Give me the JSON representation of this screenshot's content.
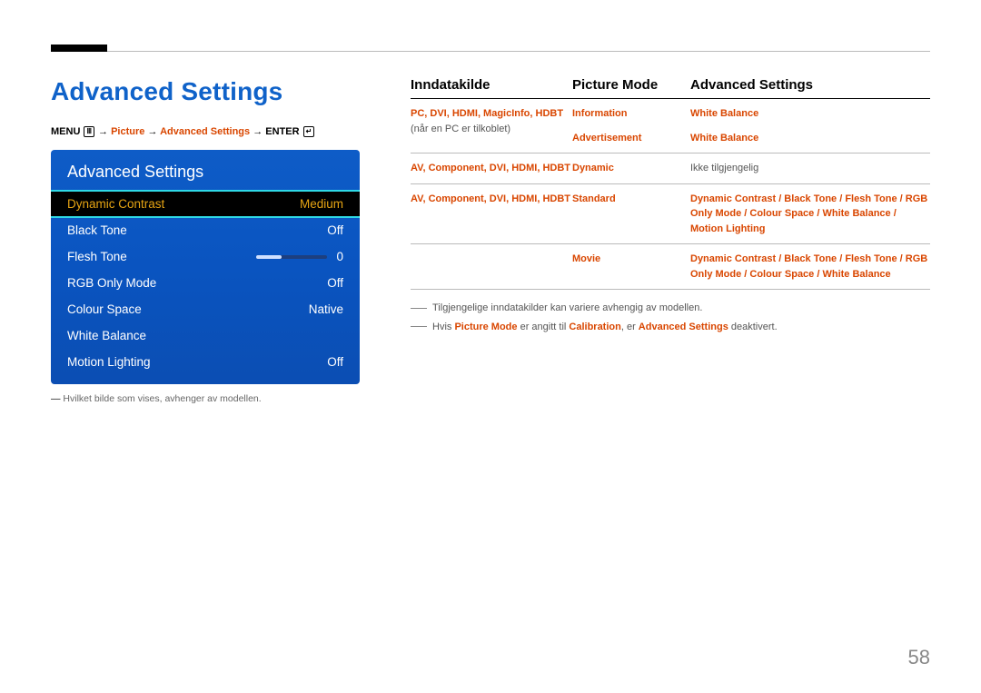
{
  "page": {
    "title": "Advanced Settings",
    "number": "58"
  },
  "breadcrumb": {
    "menu": "MENU",
    "arrow": "→",
    "picture": "Picture",
    "advanced": "Advanced Settings",
    "enter": "ENTER"
  },
  "osd": {
    "title": "Advanced Settings",
    "rows": [
      {
        "label": "Dynamic Contrast",
        "value": "Medium",
        "selected": true
      },
      {
        "label": "Black Tone",
        "value": "Off"
      },
      {
        "label": "Flesh Tone",
        "value": "0",
        "slider": true
      },
      {
        "label": "RGB Only Mode",
        "value": "Off"
      },
      {
        "label": "Colour Space",
        "value": "Native"
      },
      {
        "label": "White Balance",
        "value": ""
      },
      {
        "label": "Motion Lighting",
        "value": "Off"
      }
    ]
  },
  "footnote_left": "Hvilket bilde som vises, avhenger av modellen.",
  "table": {
    "headers": {
      "a": "Inndatakilde",
      "b": "Picture Mode",
      "c": "Advanced Settings"
    },
    "rows": [
      {
        "a_bold": "PC, DVI, HDMI, MagicInfo, HDBT",
        "a_tail": " (når en PC er tilkoblet)",
        "b1": "Information",
        "b2": "Advertisement",
        "c1": "White Balance",
        "c2": "White Balance"
      },
      {
        "a_bold": "AV, Component, DVI, HDMI, HDBT",
        "b1": "Dynamic",
        "c_plain": "Ikke tilgjengelig"
      },
      {
        "a_bold": "AV, Component, DVI, HDMI, HDBT",
        "b1": "Standard",
        "c_parts": "Dynamic Contrast / Black Tone / Flesh Tone / RGB Only Mode / Colour Space / White Balance / Motion Lighting"
      },
      {
        "b1": "Movie",
        "c_parts": "Dynamic Contrast / Black Tone / Flesh Tone / RGB Only Mode / Colour Space / White Balance"
      }
    ]
  },
  "notes": {
    "n1": "Tilgjengelige inndatakilder kan variere avhengig av modellen.",
    "n2_pre": "Hvis ",
    "n2_pm": "Picture Mode",
    "n2_mid": " er angitt til ",
    "n2_cal": "Calibration",
    "n2_mid2": ", er ",
    "n2_as": "Advanced Settings",
    "n2_post": " deaktivert."
  }
}
